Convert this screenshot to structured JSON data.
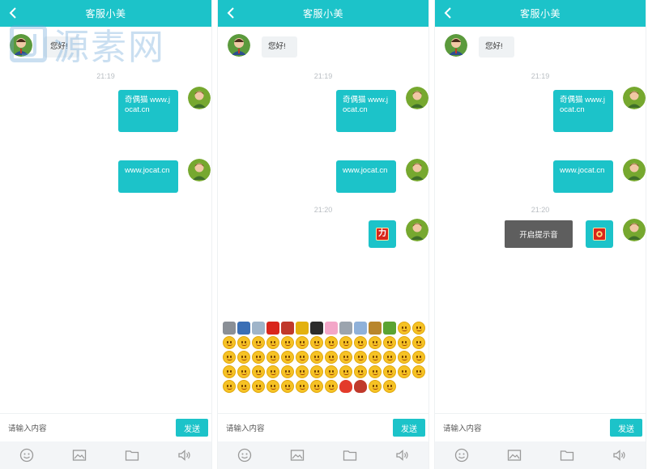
{
  "header": {
    "title": "客服小美"
  },
  "watermark": {
    "text": "源素网"
  },
  "messages": {
    "greeting": "您好!",
    "time1": "21:19",
    "msg1": "奇偶猫 www.jocat.cn",
    "msg2": "www.jocat.cn",
    "time2": "21:20",
    "sticker_char": "力"
  },
  "tooltip": {
    "text": "开启提示音"
  },
  "input": {
    "placeholder": "请输入内容",
    "value": ""
  },
  "send": {
    "label": "发送"
  },
  "toolbar": {
    "icons": [
      "emoji-icon",
      "image-icon",
      "folder-icon",
      "sound-icon"
    ]
  },
  "colors": {
    "accent": "#1cc3c9",
    "bubble_left": "#eff2f4",
    "tooltip_bg": "#5e5e5e",
    "toolbar_bg": "#f3f5f7"
  },
  "emoji_panel": {
    "count": 68
  }
}
